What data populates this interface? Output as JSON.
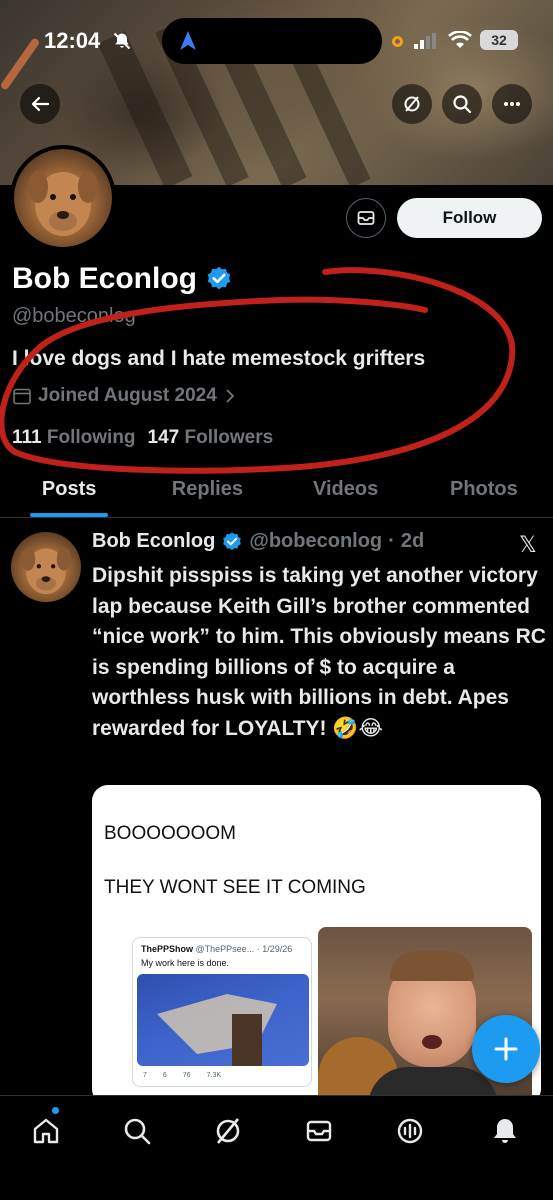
{
  "status_bar": {
    "time": "12:04",
    "battery": "32"
  },
  "profile": {
    "name": "Bob Econlog",
    "handle": "@bobeconlog",
    "bio": "I love dogs and I hate memestock grifters",
    "joined": "Joined August 2024",
    "following_count": "111",
    "following_label": "Following",
    "followers_count": "147",
    "followers_label": "Followers",
    "follow_button": "Follow"
  },
  "tabs": [
    {
      "label": "Posts",
      "active": true
    },
    {
      "label": "Replies",
      "active": false
    },
    {
      "label": "Videos",
      "active": false
    },
    {
      "label": "Photos",
      "active": false
    }
  ],
  "tweet": {
    "author_name": "Bob Econlog",
    "author_handle": "@bobeconlog",
    "time": "2d",
    "text": "Dipshit pisspiss is taking yet another victory lap because Keith Gill’s brother commented “nice work” to him. This obviously means RC is spending billions of $ to acquire a worthless husk with billions in debt. Apes rewarded for LOYALTY! 🤣😂",
    "embed": {
      "line1": "BOOOOOOOM",
      "line2": "THEY WONT SEE IT COMING",
      "inner_name": "ThePPShow",
      "inner_handle": "@ThePPsee... · 1/29/26",
      "inner_text": "My work here is done.",
      "inner_actions": [
        "7",
        "6",
        "76",
        "7.3K"
      ]
    }
  },
  "colors": {
    "accent": "#1d9bf0",
    "verified": "#1d9bf0",
    "scribble": "#c0211b"
  },
  "icons": {
    "back": "arrow-left-icon",
    "grok": "grok-icon",
    "search": "search-icon",
    "more": "more-icon",
    "message": "mail-icon",
    "home": "home-icon",
    "explore": "search-icon",
    "grok_nav": "grok-icon",
    "messages_nav": "mail-icon",
    "spaces": "spaces-icon",
    "notifications": "bell-icon",
    "compose": "plus-icon"
  }
}
